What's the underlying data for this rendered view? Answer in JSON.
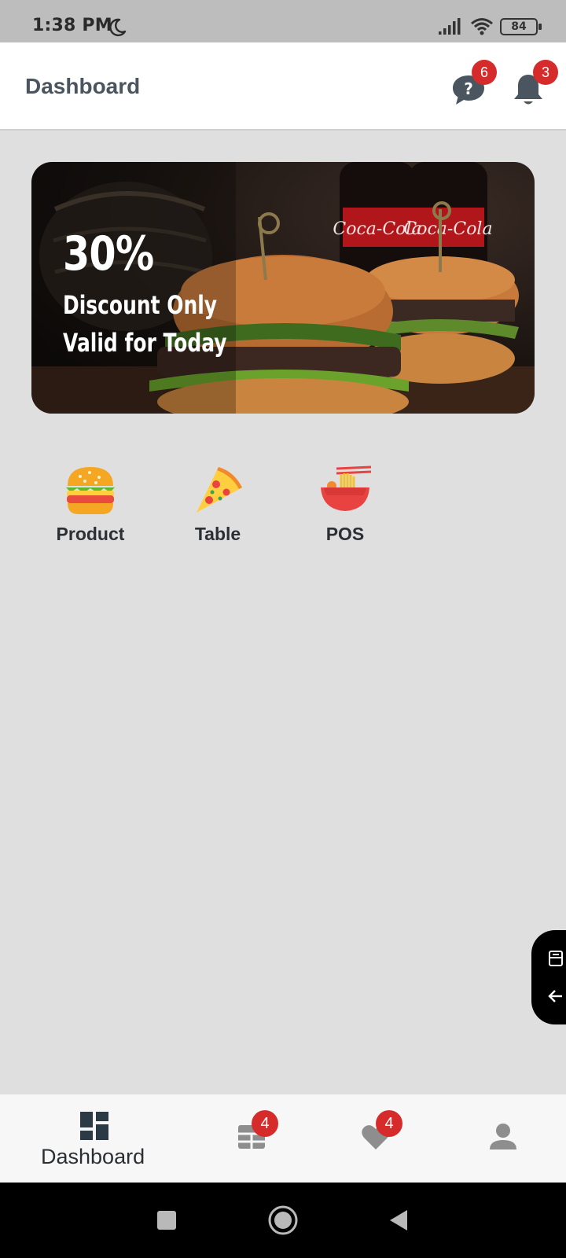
{
  "status_bar": {
    "time": "1:38 PM",
    "battery": "84",
    "icons": [
      "moon-icon",
      "signal-icon",
      "wifi-icon",
      "battery-icon"
    ]
  },
  "header": {
    "title": "Dashboard",
    "chat_badge": "6",
    "notification_badge": "3"
  },
  "banner": {
    "percent": "30%",
    "line1": "Discount Only",
    "line2": "Valid for Today",
    "image_logo_text": "Coca-Cola"
  },
  "menu": {
    "items": [
      {
        "label": "Product",
        "icon": "burger-icon"
      },
      {
        "label": "Table",
        "icon": "pizza-icon"
      },
      {
        "label": "POS",
        "icon": "noodle-bowl-icon"
      }
    ]
  },
  "bottom_nav": {
    "items": [
      {
        "label": "Dashboard",
        "icon": "dashboard-icon",
        "badge": ""
      },
      {
        "label": "",
        "icon": "table-grid-icon",
        "badge": "4"
      },
      {
        "label": "",
        "icon": "heart-icon",
        "badge": "4"
      },
      {
        "label": "",
        "icon": "person-icon",
        "badge": ""
      }
    ]
  },
  "colors": {
    "badge": "#d62b2b",
    "background": "#dfdfdf",
    "title": "#4a5560",
    "icon": "#4a5560"
  }
}
